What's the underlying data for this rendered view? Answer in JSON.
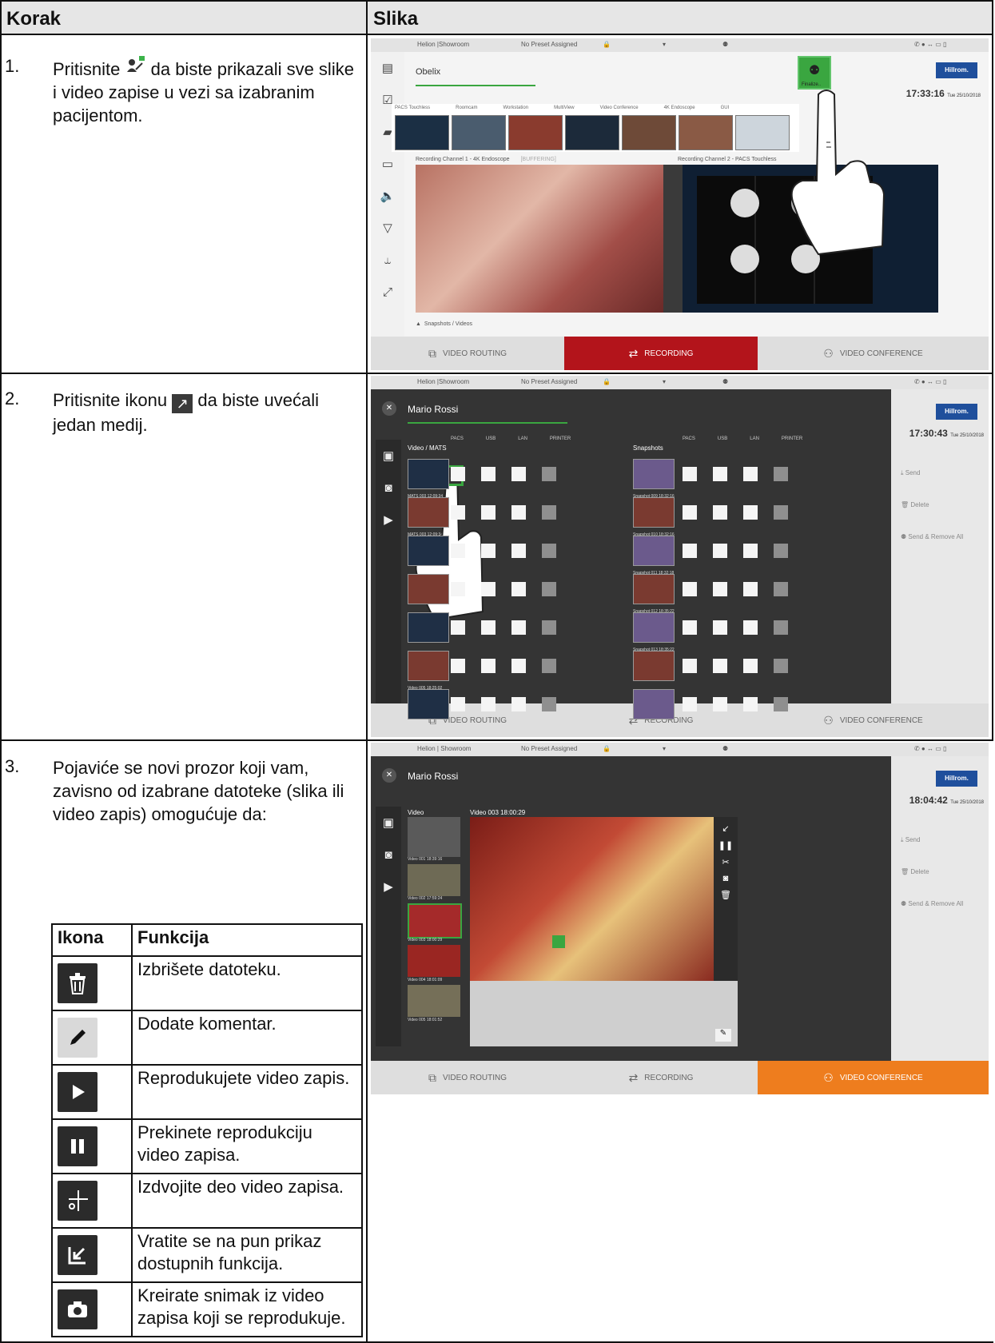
{
  "header": {
    "col_step": "Korak",
    "col_image": "Slika"
  },
  "steps": [
    {
      "number": "1.",
      "text_before": "Pritisnite",
      "icon_caption": "Finalize..",
      "text_after": "da biste prikazali sve slike i video zapise u vezi sa izabranim pacijentom.",
      "screen": {
        "topbar": {
          "room": "Helion |Showroom",
          "preset": "No Preset Assigned"
        },
        "patient": "Obelix",
        "time": "17:33:16",
        "date": "Tue 25/10/2018",
        "brand": "Hillrom.",
        "finalize_label": "Finalize..",
        "sources": [
          "PACS Touchless",
          "Roomcam",
          "Workstation",
          "MultiView",
          "Video Conference",
          "4K Endoscope",
          "GUI"
        ],
        "channel1": "Recording Channel 1 - 4K Endoscope",
        "channel1_state": "[BUFFERING]",
        "channel2": "Recording Channel 2 - PACS Touchless",
        "snapshots_label": "Snapshots / Videos",
        "tabs": [
          "VIDEO ROUTING",
          "RECORDING",
          "VIDEO CONFERENCE"
        ]
      }
    },
    {
      "number": "2.",
      "text_before": "Pritisnite ikonu",
      "text_after": "da biste uvećali jedan medij.",
      "screen": {
        "topbar": {
          "room": "Helion |Showroom",
          "preset": "No Preset Assigned"
        },
        "patient": "Mario Rossi",
        "time": "17:30:43",
        "date": "Tue 25/10/2018",
        "brand": "Hillrom.",
        "video_header": "Video / MATS",
        "snap_header": "Snapshots",
        "columns": [
          "PACS",
          "USB",
          "LAN",
          "PRINTER"
        ],
        "video_items": [
          "MATS 003 12:09:34",
          "MATS 003 12:09:34",
          "",
          "",
          "Video 005 18:25:02"
        ],
        "snap_items": [
          "Snapshot 009 18:32:16",
          "Snapshot 010 18:32:16",
          "Snapshot 011 18:32:18",
          "Snapshot 012 18:35:22",
          "Snapshot 013 18:35:22"
        ],
        "actions": [
          "Send",
          "Delete",
          "Send & Remove All"
        ],
        "tabs": [
          "VIDEO ROUTING",
          "RECORDING",
          "VIDEO CONFERENCE"
        ]
      }
    },
    {
      "number": "3.",
      "text": "Pojaviće se novi prozor koji vam, zavisno od izabrane datoteke (slika ili video zapis) omogućuje da:",
      "screen": {
        "topbar": {
          "room": "Helion | Showroom",
          "preset": "No Preset Assigned"
        },
        "patient": "Mario Rossi",
        "time": "18:04:42",
        "date": "Tue 25/10/2018",
        "brand": "Hillrom.",
        "video_label": "Video",
        "video_title": "Video 003 18:00:29",
        "list": [
          "Video 001 18:39:16",
          "Video 002 17:59:24",
          "Video 003 18:00:29",
          "Video 004 18:01:09",
          "Video 005 18:01:52"
        ],
        "actions": [
          "Send",
          "Delete",
          "Send & Remove All"
        ],
        "tabs": [
          "VIDEO ROUTING",
          "RECORDING",
          "VIDEO CONFERENCE"
        ]
      }
    }
  ],
  "icon_table": {
    "head_icon": "Ikona",
    "head_function": "Funkcija",
    "rows": [
      {
        "icon": "trash-icon",
        "text": "Izbrišete datoteku."
      },
      {
        "icon": "pencil-icon",
        "text": "Dodate komentar."
      },
      {
        "icon": "play-icon",
        "text": "Reprodukujete video zapis."
      },
      {
        "icon": "pause-icon",
        "text": "Prekinete reprodukciju video zapisa."
      },
      {
        "icon": "cut-icon",
        "text": "Izdvojite deo video zapisa."
      },
      {
        "icon": "return-icon",
        "text": "Vratite se na pun prikaz dostupnih funkcija."
      },
      {
        "icon": "camera-icon",
        "text": "Kreirate snimak iz video zapisa koji se reprodukuje."
      }
    ]
  }
}
